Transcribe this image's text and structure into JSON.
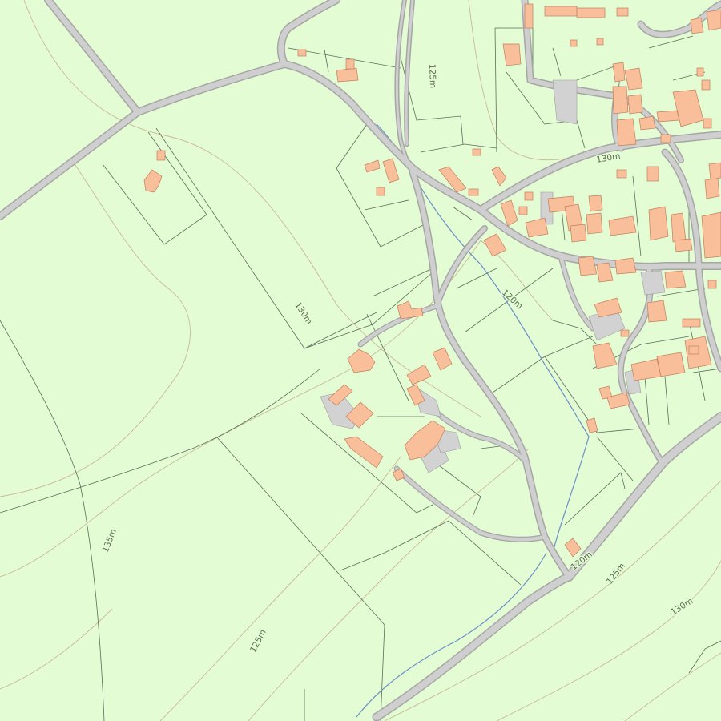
{
  "map": {
    "colors": {
      "land": "#e3fcd3",
      "road": "#c9c9c9",
      "road_edge": "#a6a6a6",
      "building": "#f9bf9a",
      "building_edge": "#c27f5c",
      "yard": "#d2d2d2",
      "field_boundary": "#5c6e5c",
      "contour": "#c9b995",
      "stream": "#6a8fc9"
    },
    "contour_labels": [
      {
        "id": "contour-label-130m-center",
        "text": "130m"
      },
      {
        "id": "contour-label-135m",
        "text": "135m"
      },
      {
        "id": "contour-label-125m-south",
        "text": "125m"
      },
      {
        "id": "contour-label-125m-north",
        "text": "125m"
      },
      {
        "id": "contour-label-130m-village",
        "text": "130m"
      },
      {
        "id": "contour-label-120m-stream",
        "text": "120m"
      },
      {
        "id": "contour-label-120m-bypass",
        "text": "120m"
      },
      {
        "id": "contour-label-125m-east",
        "text": "125m"
      },
      {
        "id": "contour-label-130m-east",
        "text": "130m"
      }
    ]
  }
}
